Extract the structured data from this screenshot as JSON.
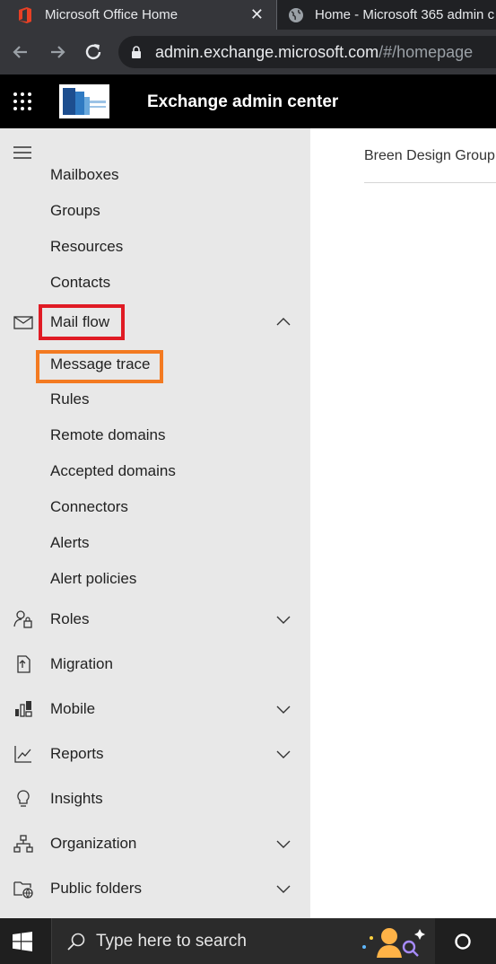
{
  "browser": {
    "tabs": [
      {
        "title": "Microsoft Office Home",
        "icon": "office-icon",
        "active": true
      },
      {
        "title": "Home - Microsoft 365 admin c",
        "icon": "globe-icon",
        "active": false
      }
    ],
    "url_host": "admin.exchange.microsoft.com",
    "url_path": "/#/homepage"
  },
  "header": {
    "title": "Exchange admin center"
  },
  "nav": {
    "items": [
      {
        "label": "Mailboxes"
      },
      {
        "label": "Groups"
      },
      {
        "label": "Resources"
      },
      {
        "label": "Contacts"
      },
      {
        "label": "Mail flow",
        "icon": "mail-icon",
        "expanded": true
      },
      {
        "label": "Message trace"
      },
      {
        "label": "Rules"
      },
      {
        "label": "Remote domains"
      },
      {
        "label": "Accepted domains"
      },
      {
        "label": "Connectors"
      },
      {
        "label": "Alerts"
      },
      {
        "label": "Alert policies"
      },
      {
        "label": "Roles",
        "icon": "roles-icon"
      },
      {
        "label": "Migration",
        "icon": "migration-icon"
      },
      {
        "label": "Mobile",
        "icon": "mobile-icon"
      },
      {
        "label": "Reports",
        "icon": "reports-icon"
      },
      {
        "label": "Insights",
        "icon": "lightbulb-icon"
      },
      {
        "label": "Organization",
        "icon": "organization-icon"
      },
      {
        "label": "Public folders",
        "icon": "public-folders-icon"
      }
    ]
  },
  "main": {
    "org_name": "Breen Design Group"
  },
  "taskbar": {
    "search_placeholder": "Type here to search"
  },
  "colors": {
    "highlight_red": "#e01b24",
    "highlight_orange": "#f37a21"
  }
}
